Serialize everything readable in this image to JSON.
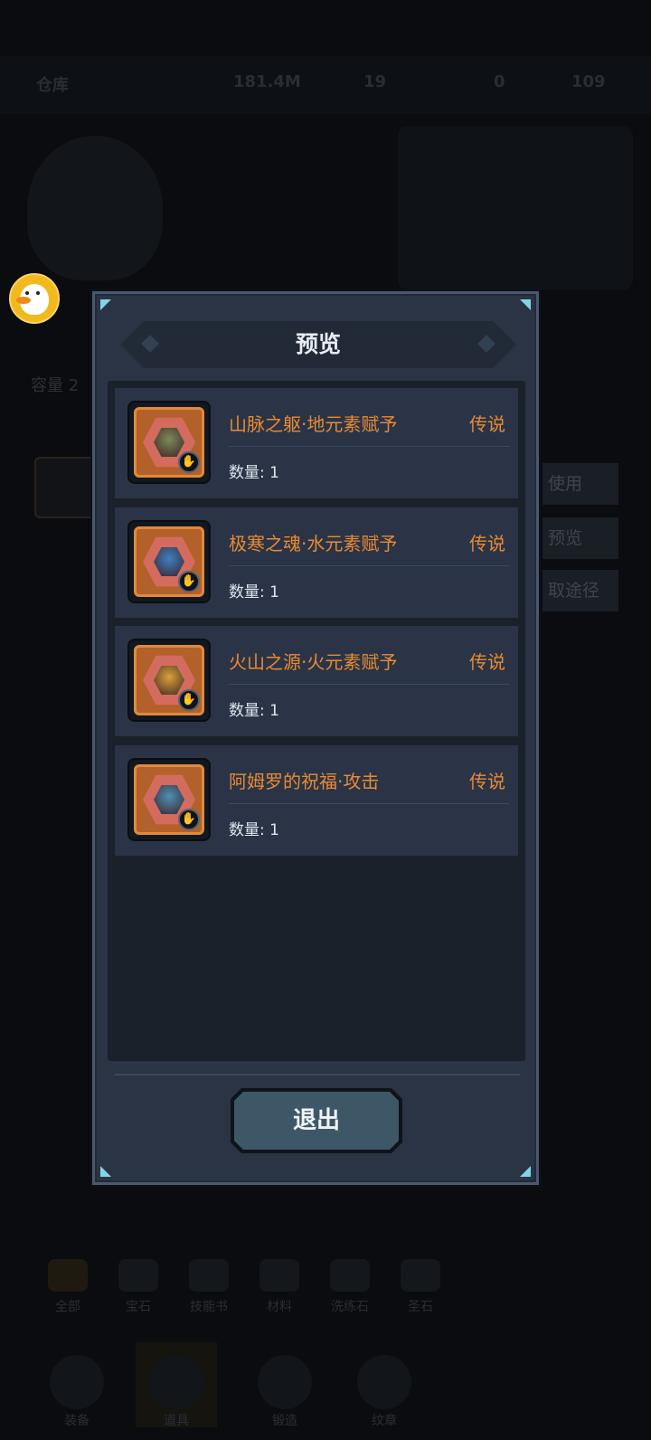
{
  "background": {
    "top_bar": {
      "warehouse_label": "仓库",
      "gold": "181.4M",
      "currency_2": "19",
      "currency_3": "0",
      "currency_4": "109"
    },
    "left_label": "容量 2",
    "side_buttons": [
      "使用",
      "预览",
      "取途径"
    ],
    "nav_row_1": [
      "全部",
      "宝石",
      "技能书",
      "材料",
      "洗练石",
      "圣石"
    ],
    "nav_row_2": [
      "装备",
      "道具",
      "锻造",
      "纹章"
    ]
  },
  "modal": {
    "title": "预览",
    "items": [
      {
        "name": "山脉之躯·地元素赋予",
        "rarity": "传说",
        "quantity": "数量: 1",
        "tint": "#7b8a5a"
      },
      {
        "name": "极寒之魂·水元素赋予",
        "rarity": "传说",
        "quantity": "数量: 1",
        "tint": "#3f7fc4"
      },
      {
        "name": "火山之源·火元素赋予",
        "rarity": "传说",
        "quantity": "数量: 1",
        "tint": "#d9a23a"
      },
      {
        "name": "阿姆罗的祝福·攻击",
        "rarity": "传说",
        "quantity": "数量: 1",
        "tint": "#4d8fb5"
      }
    ],
    "exit_label": "退出"
  },
  "colors": {
    "rarity_legendary": "#e98a33",
    "panel": "#2b3444",
    "accent_corner": "#7fd6e6"
  },
  "icons": [
    "duck-avatar-icon",
    "hand-icon",
    "gold-coin-icon"
  ]
}
